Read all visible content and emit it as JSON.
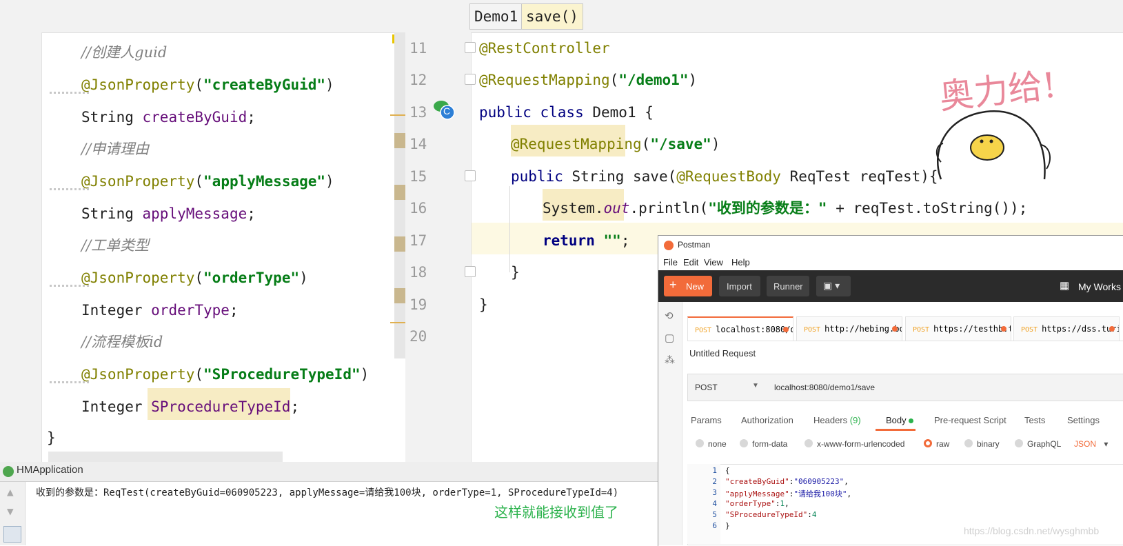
{
  "left_editor": {
    "lines": [
      {
        "type": "comment",
        "text": "//创建人guid"
      },
      {
        "type": "anno",
        "anno": "@JsonProperty",
        "open": "(",
        "str": "\"createByGuid\"",
        "close": ")"
      },
      {
        "type": "decl",
        "typename": "String ",
        "field": "createByGuid",
        "end": ";"
      },
      {
        "type": "comment",
        "text": "//申请理由"
      },
      {
        "type": "anno",
        "anno": "@JsonProperty",
        "open": "(",
        "str": "\"applyMessage\"",
        "close": ")"
      },
      {
        "type": "decl",
        "typename": "String ",
        "field": "applyMessage",
        "end": ";"
      },
      {
        "type": "comment",
        "text": "//工单类型"
      },
      {
        "type": "anno",
        "anno": "@JsonProperty",
        "open": "(",
        "str": "\"orderType\"",
        "close": ")"
      },
      {
        "type": "decl",
        "typename": "Integer ",
        "field": "orderType",
        "end": ";"
      },
      {
        "type": "comment",
        "text": "//流程模板id"
      },
      {
        "type": "anno",
        "anno": "@JsonProperty",
        "open": "(",
        "str": "\"SProcedureTypeId\"",
        "close": ")"
      },
      {
        "type": "decl",
        "typename": "Integer ",
        "field": "SProcedureTypeId",
        "end": ";"
      }
    ],
    "closing_brace": "}"
  },
  "right_editor": {
    "breadcrumbs": [
      "Demo1",
      "save()"
    ],
    "line_numbers": [
      "11",
      "12",
      "13",
      "14",
      "15",
      "16",
      "17",
      "18",
      "19",
      "20"
    ],
    "line11": "@RestController",
    "line12": {
      "anno": "@RequestMapping",
      "open": "(",
      "str": "\"/demo1\"",
      "close": ")"
    },
    "line13": {
      "kw": "public class ",
      "name": "Demo1 {"
    },
    "line14": {
      "anno": "@RequestMapping",
      "open": "(",
      "str": "\"/save\"",
      "close": ")"
    },
    "line15": {
      "kw": "public ",
      "t1": "String save(",
      "anno": "@RequestBody",
      "t2": " ReqTest reqTest){"
    },
    "line16": {
      "sys": "System.",
      "out": "out",
      "rest1": ".println(",
      "str": "\"收到的参数是：\"",
      "rest2": " + reqTest.toString());"
    },
    "line17": {
      "kw": "return ",
      "str": "\"\"",
      "end": ";"
    },
    "line18": "}",
    "line19": "}",
    "class_icon_letter": "C"
  },
  "sticker": {
    "text": "奥力给!"
  },
  "console": {
    "title": "HMApplication",
    "output": "收到的参数是：ReqTest(createByGuid=060905223, applyMessage=请给我100块, orderType=1, SProcedureTypeId=4)",
    "note": "这样就能接收到值了",
    "note_color": "#2bb24c"
  },
  "postman": {
    "title": "Postman",
    "menu": [
      "File",
      "Edit",
      "View",
      "Help"
    ],
    "toolbar": {
      "new": "New",
      "import": "Import",
      "runner": "Runner",
      "workspace": "My Works"
    },
    "tabs": [
      {
        "method": "POST",
        "url": "localhost:8080/d..."
      },
      {
        "method": "POST",
        "url": "http://hebing.bo..."
      },
      {
        "method": "POST",
        "url": "https://testhb.tur..."
      },
      {
        "method": "POST",
        "url": "https://dss.turing..."
      }
    ],
    "request_name": "Untitled Request",
    "method": "POST",
    "url": "localhost:8080/demo1/save",
    "subtabs": {
      "params": "Params",
      "authorization": "Authorization",
      "headers": "Headers",
      "headers_count": "(9)",
      "body": "Body",
      "prerequest": "Pre-request Script",
      "tests": "Tests",
      "settings": "Settings"
    },
    "body_types": [
      "none",
      "form-data",
      "x-www-form-urlencoded",
      "raw",
      "binary",
      "GraphQL"
    ],
    "body_format": "JSON",
    "code_numbers": [
      "1",
      "2",
      "3",
      "4",
      "5",
      "6"
    ],
    "code": {
      "open": "{",
      "k1": "\"createByGuid\"",
      "v1": "\"060905223\"",
      "k2": "\"applyMessage\"",
      "v2": "\"请给我100块\"",
      "k3": "\"orderType\"",
      "v3": "1",
      "k4": "\"SProcedureTypeId\"",
      "v4": "4",
      "close": "}"
    },
    "accent": "#f26b3a"
  },
  "watermark": "https://blog.csdn.net/wysghmbb"
}
